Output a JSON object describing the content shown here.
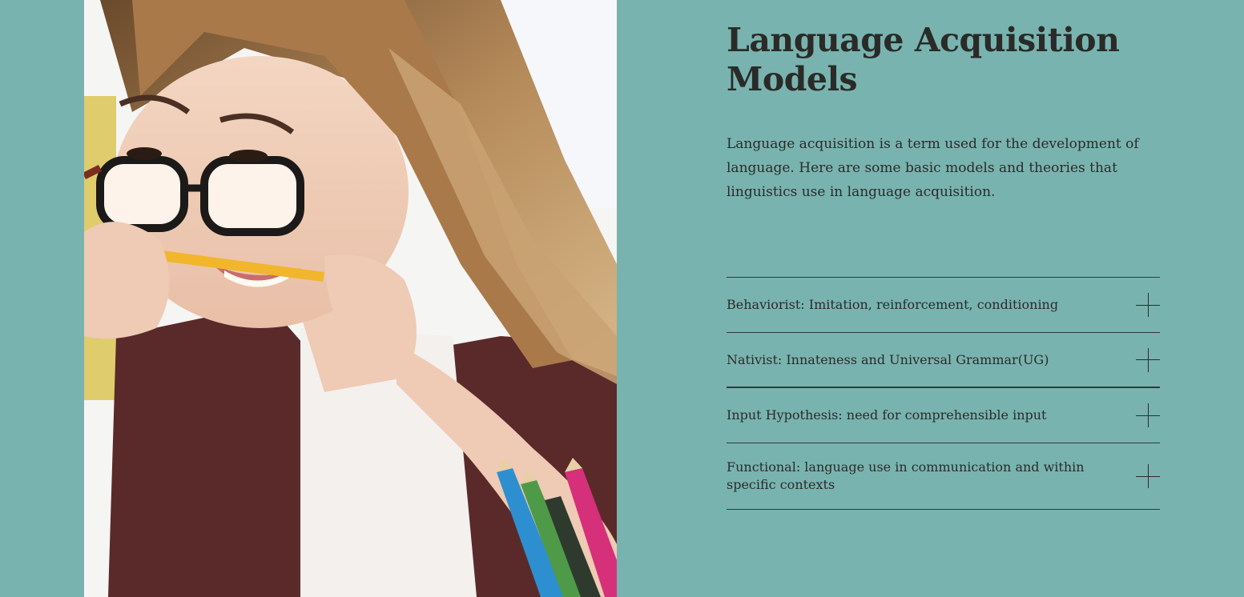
{
  "page": {
    "background_color": "#79b3af"
  },
  "hero_image": {
    "alt": "Woman with glasses biting a yellow pencil, holding colored pencils"
  },
  "section": {
    "title": "Language Acquisition Models",
    "intro": "Language acquisition is a term used for the development of language. Here are some basic models and theories that linguistics use in language acquisition."
  },
  "accordion": {
    "items": [
      {
        "label": "Behaviorist: Imitation, reinforcement, conditioning",
        "icon": "plus-icon"
      },
      {
        "label": "Nativist: Innateness and Universal Grammar(UG)",
        "icon": "plus-icon"
      },
      {
        "label": "Input Hypothesis: need for comprehensible input",
        "icon": "plus-icon"
      },
      {
        "label": "Functional: language use in communication and within specific contexts",
        "icon": "plus-icon"
      }
    ]
  }
}
